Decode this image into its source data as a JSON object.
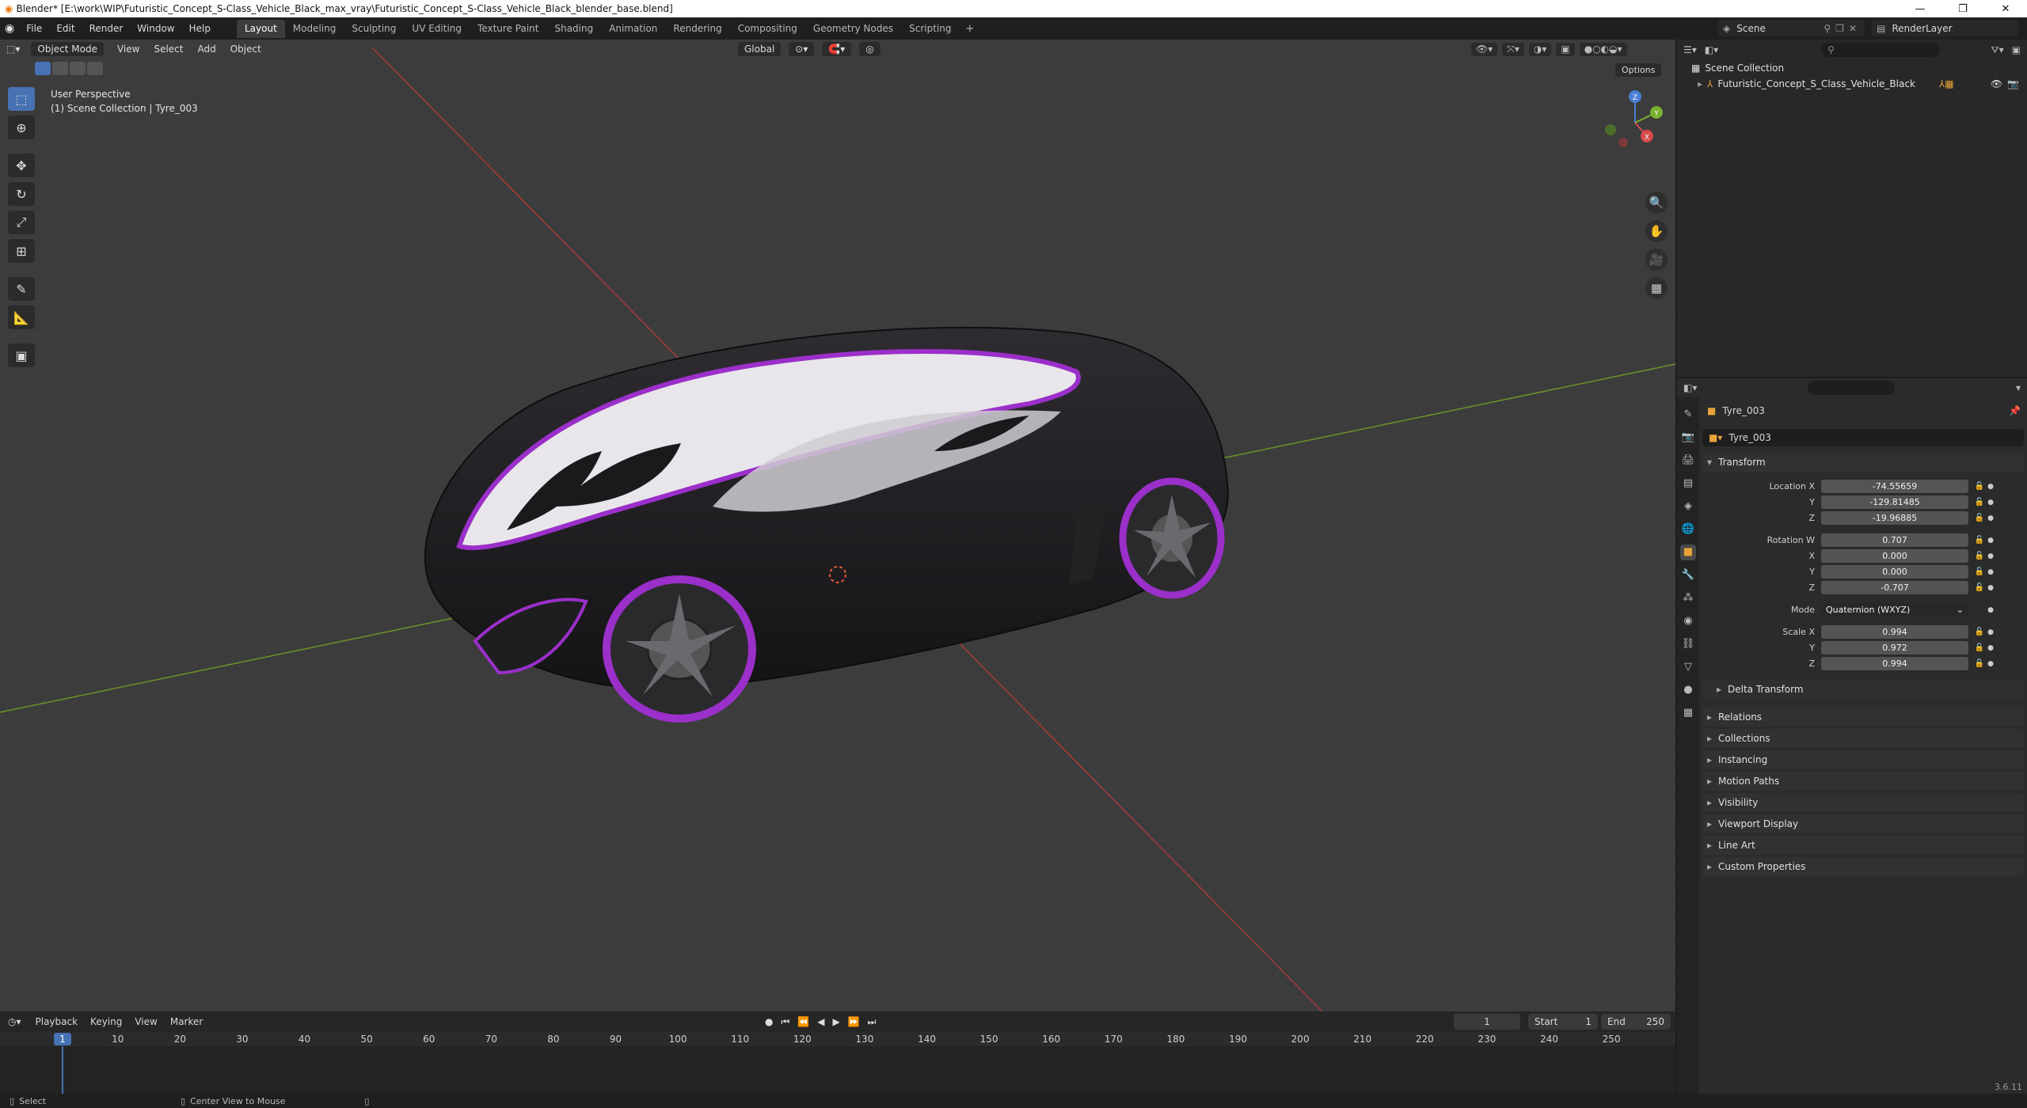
{
  "window": {
    "title": "Blender* [E:\\work\\WIP\\Futuristic_Concept_S-Class_Vehicle_Black_max_vray\\Futuristic_Concept_S-Class_Vehicle_Black_blender_base.blend]"
  },
  "menu": [
    "File",
    "Edit",
    "Render",
    "Window",
    "Help"
  ],
  "workspaces": {
    "tabs": [
      "Layout",
      "Modeling",
      "Sculpting",
      "UV Editing",
      "Texture Paint",
      "Shading",
      "Animation",
      "Rendering",
      "Compositing",
      "Geometry Nodes",
      "Scripting"
    ],
    "active": "Layout"
  },
  "scene": {
    "name": "Scene",
    "render_layer": "RenderLayer"
  },
  "viewport": {
    "mode": "Object Mode",
    "menus": [
      "View",
      "Select",
      "Add",
      "Object"
    ],
    "transform_orientation": "Global",
    "perspective_label": "User Perspective",
    "collection_label": "(1) Scene Collection | Tyre_003",
    "options_label": "Options"
  },
  "gizmo": {
    "z": "Z",
    "y": "Y",
    "x": "X"
  },
  "outliner": {
    "root": "Scene Collection",
    "items": [
      "Futuristic_Concept_S_Class_Vehicle_Black"
    ]
  },
  "properties": {
    "object_name": "Tyre_003",
    "object_field": "Tyre_003",
    "transform": {
      "title": "Transform",
      "location_label": "Location X",
      "location": [
        "-74.55659",
        "-129.81485",
        "-19.96885"
      ],
      "rotation_label": "Rotation W",
      "rotation": [
        "0.707",
        "0.000",
        "0.000",
        "-0.707"
      ],
      "mode_label": "Mode",
      "mode_value": "Quaternion (WXYZ)",
      "scale_label": "Scale X",
      "scale": [
        "0.994",
        "0.972",
        "0.994"
      ],
      "axis": [
        "Y",
        "Z",
        "X"
      ]
    },
    "delta_transform": "Delta Transform",
    "panels": [
      "Relations",
      "Collections",
      "Instancing",
      "Motion Paths",
      "Visibility",
      "Viewport Display",
      "Line Art",
      "Custom Properties"
    ]
  },
  "timeline": {
    "menus": [
      "Playback",
      "Keying",
      "View",
      "Marker"
    ],
    "current_frame": "1",
    "start_label": "Start",
    "start": "1",
    "end_label": "End",
    "end": "250",
    "ruler": [
      "10",
      "20",
      "30",
      "40",
      "50",
      "60",
      "70",
      "80",
      "90",
      "100",
      "110",
      "120",
      "130",
      "140",
      "150",
      "160",
      "170",
      "180",
      "190",
      "200",
      "210",
      "220",
      "230",
      "240",
      "250"
    ]
  },
  "statusbar": {
    "select": "Select",
    "center_view": "Center View to Mouse",
    "version": "3.6.11"
  },
  "colors": {
    "accent": "#4772b3",
    "vehicle_trim": "#9b2fc9",
    "object_orange": "#e8a43b"
  }
}
